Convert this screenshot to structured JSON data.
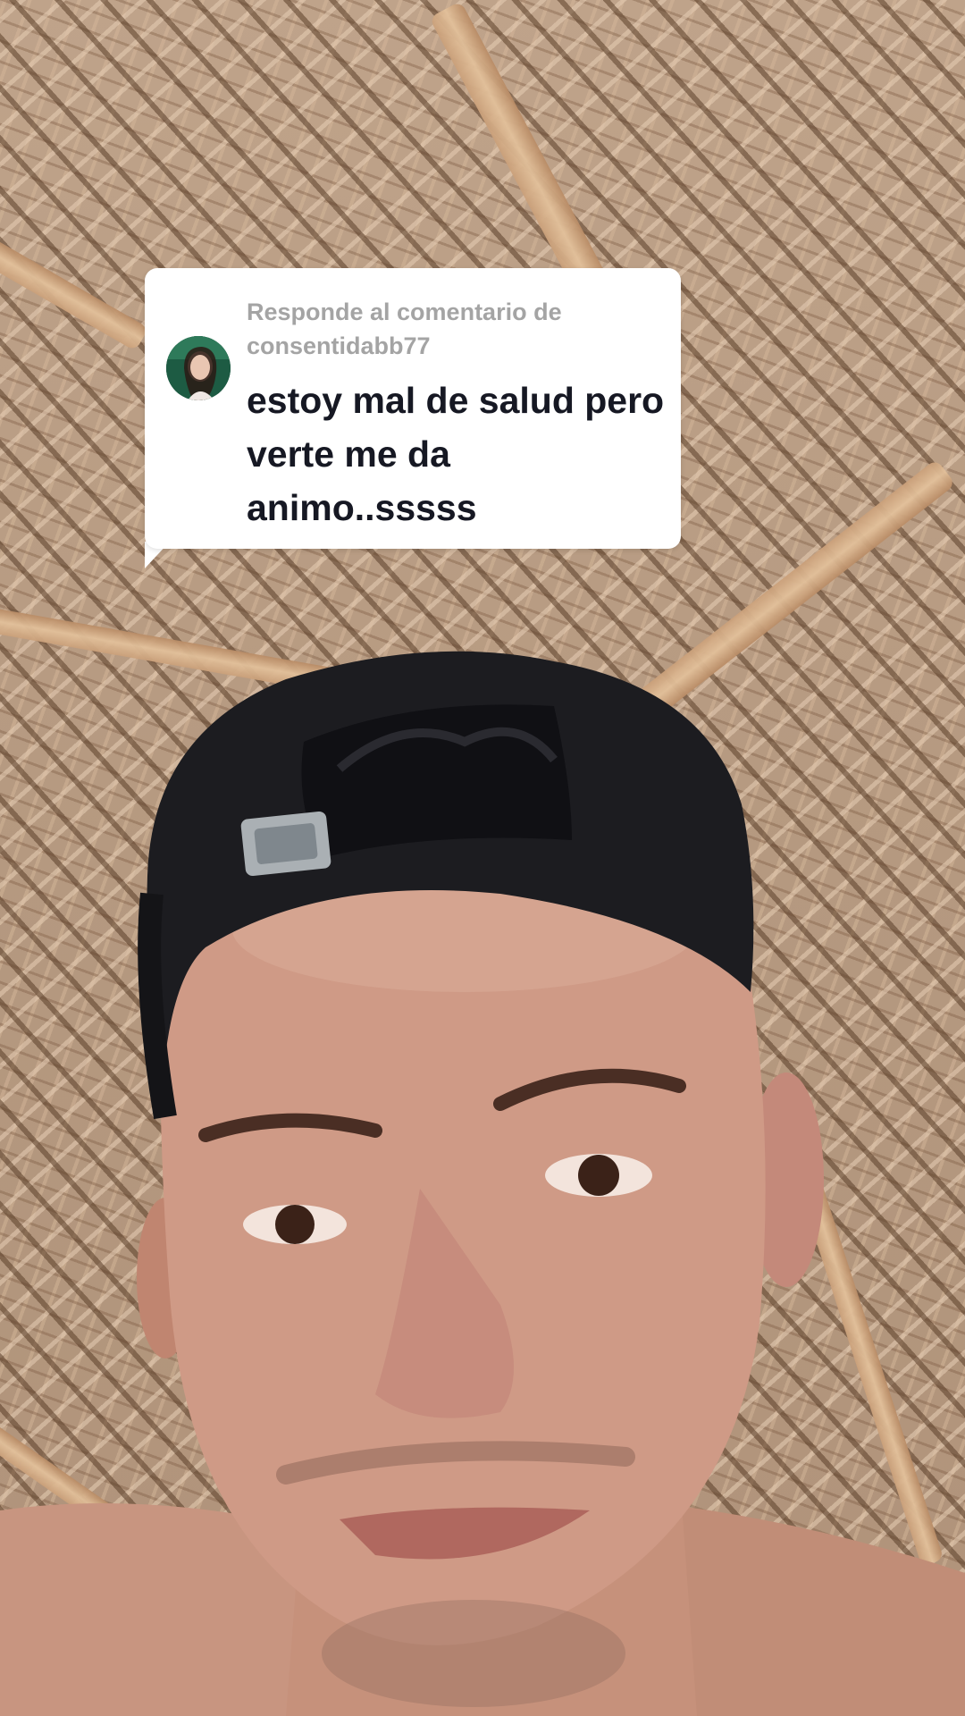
{
  "reply": {
    "prefix": "Responde al comentario de",
    "username": "consentidabb77",
    "comment": "estoy mal de salud pero verte me da animo..sssss"
  },
  "colors": {
    "card_bg": "#ffffff",
    "header_text": "#a4a4a4",
    "comment_text": "#161823"
  }
}
